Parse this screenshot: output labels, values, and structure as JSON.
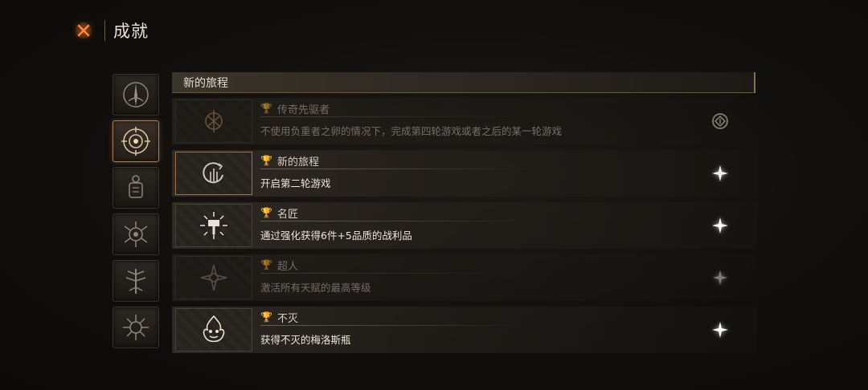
{
  "header": {
    "title": "成就"
  },
  "categories": [
    {
      "icon": "horned-sigil-icon",
      "active": false
    },
    {
      "icon": "target-compass-icon",
      "active": true
    },
    {
      "icon": "lantern-totem-icon",
      "active": false
    },
    {
      "icon": "spider-crest-icon",
      "active": false
    },
    {
      "icon": "tree-rune-icon",
      "active": false
    },
    {
      "icon": "thorn-star-icon",
      "active": false
    }
  ],
  "panel": {
    "title": "新的旅程"
  },
  "achievements": [
    {
      "name": "传奇先驱者",
      "description": "不使用负重者之卵的情况下，完成第四轮游戏或者之后的某一轮游戏",
      "icon": "emblem-cross-icon",
      "status": "in-progress-icon",
      "locked": true
    },
    {
      "name": "新的旅程",
      "description": "开启第二轮游戏",
      "icon": "cycle-sigil-icon",
      "status": "sparkle-star-icon",
      "locked": false
    },
    {
      "name": "名匠",
      "description": "通过强化获得6件+5品质的战利品",
      "icon": "radiant-hammer-icon",
      "status": "sparkle-star-icon",
      "locked": false
    },
    {
      "name": "超人",
      "description": "激活所有天赋的最高等级",
      "icon": "ascend-star-icon",
      "status": "sparkle-star-icon",
      "locked": true
    },
    {
      "name": "不灭",
      "description": "获得不灭的梅洛斯瓶",
      "icon": "flame-vessel-icon",
      "status": "sparkle-star-icon",
      "locked": false
    }
  ],
  "colors": {
    "accent_orange": "#ff7a2e",
    "gold_border": "#a8834f",
    "text": "#ece6da"
  }
}
